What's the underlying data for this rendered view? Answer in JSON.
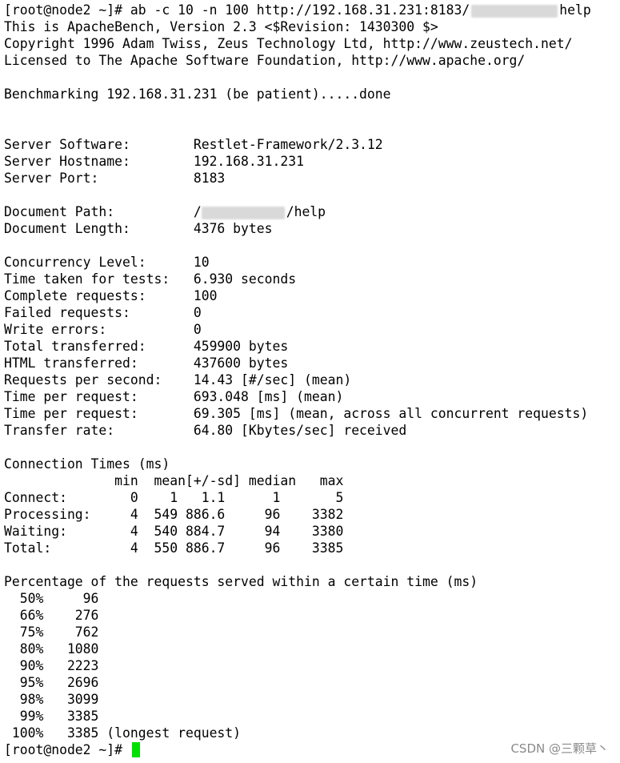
{
  "terminal": {
    "cmd_prompt": "[root@node2 ~]# ",
    "cmd_text": "ab -c 10 -n 100 http://192.168.31.231:8183/",
    "cmd_suffix": "help",
    "banner": [
      "This is ApacheBench, Version 2.3 <$Revision: 1430300 $>",
      "Copyright 1996 Adam Twiss, Zeus Technology Ltd, http://www.zeustech.net/",
      "Licensed to The Apache Software Foundation, http://www.apache.org/"
    ],
    "benchmarking": "Benchmarking 192.168.31.231 (be patient).....done",
    "server": [
      "Server Software:        Restlet-Framework/2.3.12",
      "Server Hostname:        192.168.31.231",
      "Server Port:            8183"
    ],
    "doc_path_label": "Document Path:          /",
    "doc_path_suffix": "/help",
    "doc_length": "Document Length:        4376 bytes",
    "stats": [
      "Concurrency Level:      10",
      "Time taken for tests:   6.930 seconds",
      "Complete requests:      100",
      "Failed requests:        0",
      "Write errors:           0",
      "Total transferred:      459900 bytes",
      "HTML transferred:       437600 bytes",
      "Requests per second:    14.43 [#/sec] (mean)",
      "Time per request:       693.048 [ms] (mean)",
      "Time per request:       69.305 [ms] (mean, across all concurrent requests)",
      "Transfer rate:          64.80 [Kbytes/sec] received"
    ],
    "conn_title": "Connection Times (ms)",
    "conn_table": [
      "              min  mean[+/-sd] median   max",
      "Connect:        0    1   1.1      1       5",
      "Processing:     4  549 886.6     96    3382",
      "Waiting:        4  540 884.7     94    3380",
      "Total:          4  550 886.7     96    3385"
    ],
    "pct_title": "Percentage of the requests served within a certain time (ms)",
    "pct_rows": [
      "  50%     96",
      "  66%    276",
      "  75%    762",
      "  80%   1080",
      "  90%   2223",
      "  95%   2696",
      "  98%   3099",
      "  99%   3385",
      " 100%   3385 (longest request)"
    ],
    "final_prompt": "[root@node2 ~]# "
  },
  "watermark": "CSDN @三颗草丶",
  "colors": {
    "background": "#ffffff",
    "text": "#000000",
    "cursor": "#00e000",
    "watermark": "#8a8a8a"
  }
}
